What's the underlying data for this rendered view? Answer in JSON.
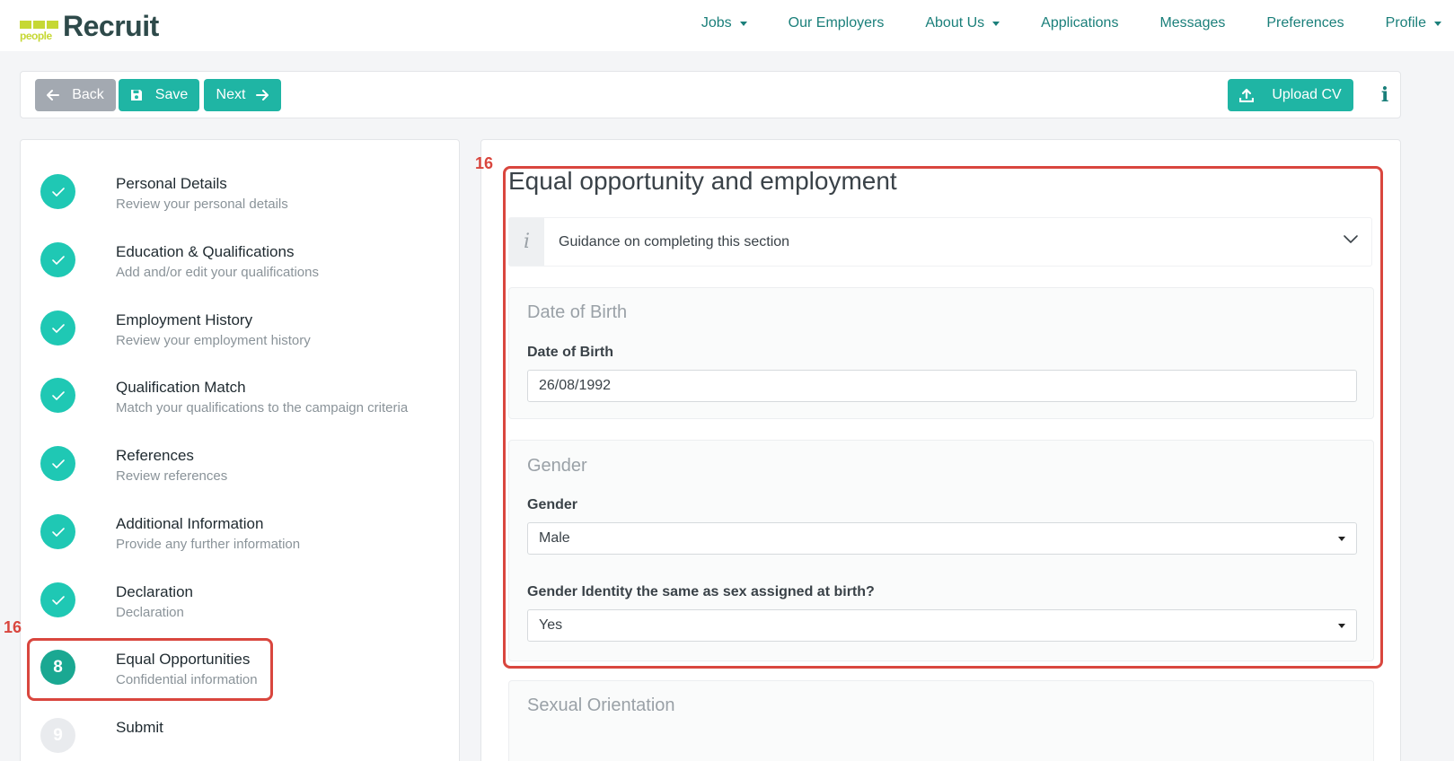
{
  "nav": {
    "logo_mark": "people",
    "logo_text": "Recruit",
    "items": [
      {
        "label": "Jobs",
        "dropdown": true
      },
      {
        "label": "Our Employers",
        "dropdown": false
      },
      {
        "label": "About Us",
        "dropdown": true
      },
      {
        "label": "Applications",
        "dropdown": false
      },
      {
        "label": "Messages",
        "dropdown": false
      },
      {
        "label": "Preferences",
        "dropdown": false
      },
      {
        "label": "Profile",
        "dropdown": true
      }
    ]
  },
  "toolbar": {
    "back_label": "Back",
    "save_label": "Save",
    "next_label": "Next",
    "upload_label": "Upload CV",
    "info_label": "i"
  },
  "steps": [
    {
      "title": "Personal Details",
      "subtitle": "Review your personal details",
      "state": "complete"
    },
    {
      "title": "Education & Qualifications",
      "subtitle": "Add and/or edit your qualifications",
      "state": "complete"
    },
    {
      "title": "Employment History",
      "subtitle": "Review your employment history",
      "state": "complete"
    },
    {
      "title": "Qualification Match",
      "subtitle": "Match your qualifications to the campaign criteria",
      "state": "complete"
    },
    {
      "title": "References",
      "subtitle": "Review references",
      "state": "complete"
    },
    {
      "title": "Additional Information",
      "subtitle": "Provide any further information",
      "state": "complete"
    },
    {
      "title": "Declaration",
      "subtitle": "Declaration",
      "state": "complete"
    },
    {
      "title": "Equal Opportunities",
      "subtitle": "Confidential information",
      "state": "active",
      "number": "8"
    },
    {
      "title": "Submit",
      "subtitle": "",
      "state": "pending",
      "number": "9"
    }
  ],
  "form": {
    "title": "Equal opportunity and employment",
    "guidance_label": "Guidance on completing this section",
    "dob_card": {
      "title": "Date of Birth",
      "field_label": "Date of Birth",
      "value": "26/08/1992"
    },
    "gender_card": {
      "title": "Gender",
      "gender_label": "Gender",
      "gender_value": "Male",
      "identity_label": "Gender Identity the same as sex assigned at birth?",
      "identity_value": "Yes"
    },
    "orientation_card": {
      "title": "Sexual Orientation"
    }
  },
  "annotations": {
    "step_marker": "16",
    "form_marker": "16"
  },
  "colors": {
    "primary": "#1fb5a4",
    "complete": "#1fc8b4",
    "active": "#1aa892",
    "back": "#a3a9b1",
    "nav_text": "#1a7f7a",
    "annotation": "#d9463e"
  }
}
